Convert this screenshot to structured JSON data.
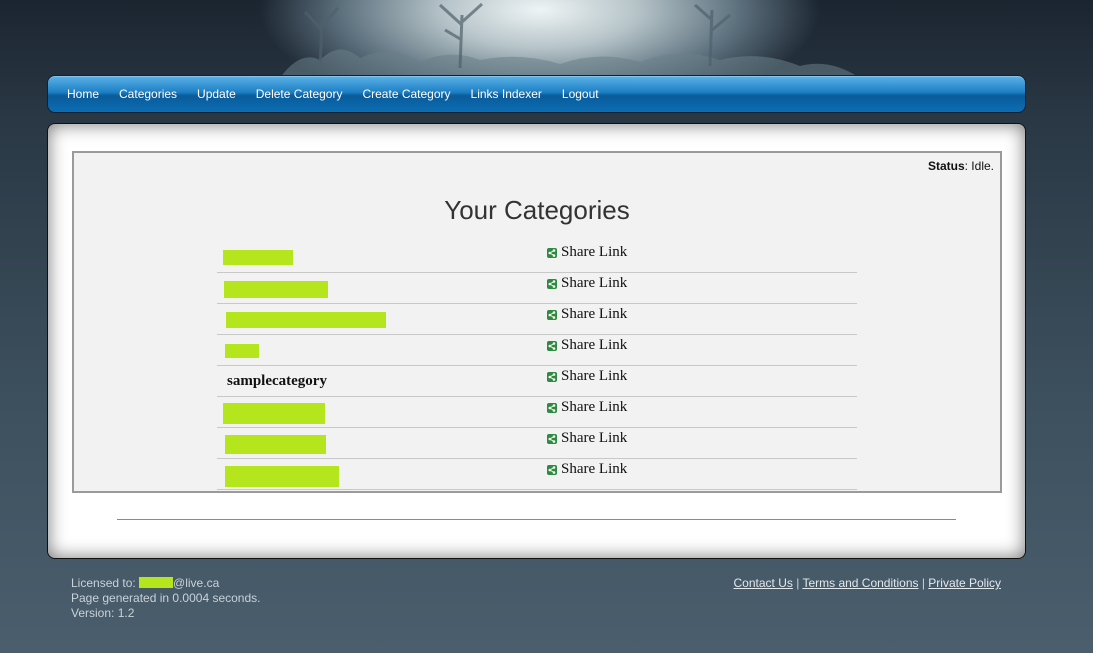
{
  "nav": {
    "items": [
      {
        "label": "Home"
      },
      {
        "label": "Categories"
      },
      {
        "label": "Update"
      },
      {
        "label": "Delete Category"
      },
      {
        "label": "Create Category"
      },
      {
        "label": "Links Indexer"
      },
      {
        "label": "Logout"
      }
    ]
  },
  "status": {
    "label": "Status",
    "value": ": Idle."
  },
  "main": {
    "title": "Your Categories",
    "categories": [
      {
        "name": "",
        "redacted": true,
        "share_label": "Share Link"
      },
      {
        "name": "",
        "redacted": true,
        "share_label": "Share Link"
      },
      {
        "name": "",
        "redacted": true,
        "share_label": "Share Link"
      },
      {
        "name": "",
        "redacted": true,
        "share_label": "Share Link"
      },
      {
        "name": "samplecategory",
        "redacted": false,
        "share_label": "Share Link"
      },
      {
        "name": "",
        "redacted": true,
        "share_label": "Share Link"
      },
      {
        "name": "",
        "redacted": true,
        "share_label": "Share Link"
      },
      {
        "name": "",
        "redacted": true,
        "share_label": "Share Link"
      }
    ]
  },
  "footer": {
    "licensed_prefix": "Licensed to: ",
    "licensed_suffix": "@live.ca",
    "generated": "Page generated in 0.0004 seconds.",
    "version": "Version: 1.2",
    "links": {
      "contact": "Contact Us",
      "terms": "Terms and Conditions",
      "privacy": "Private Policy",
      "separator": " | "
    }
  },
  "colors": {
    "redaction": "#b5e61d",
    "nav_blue": "#1e7fc4",
    "share_icon": "#2d8a3e"
  },
  "icons": {
    "share": "share-icon"
  }
}
